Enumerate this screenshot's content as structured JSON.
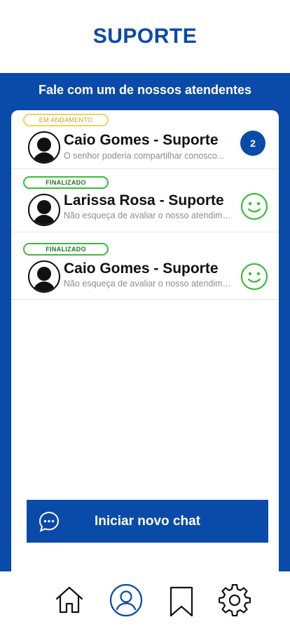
{
  "header": {
    "title": "SUPORTE"
  },
  "subtitle": "Fale com um de nossos atendentes",
  "chats": [
    {
      "status": "EM ANDAMENTO",
      "name": "Caio Gomes - Suporte",
      "preview": "O senhor poderia compartilhar conosco...",
      "unread": "2"
    },
    {
      "status": "FINALIZADO",
      "name": "Larissa Rosa - Suporte",
      "preview": "Não esqueça de avaliar o nosso atendimento",
      "rating_icon": "smiley-icon"
    },
    {
      "status": "FINALIZADO",
      "name": "Caio Gomes - Suporte",
      "preview": "Não esqueça de avaliar o nosso atendimento",
      "rating_icon": "smiley-icon"
    }
  ],
  "cta": {
    "label": "Iniciar novo chat",
    "icon": "chat-bubble-icon"
  },
  "nav": [
    {
      "name": "home",
      "icon": "home-icon"
    },
    {
      "name": "profile",
      "icon": "user-icon",
      "active": true
    },
    {
      "name": "saved",
      "icon": "bookmark-icon"
    },
    {
      "name": "settings",
      "icon": "gear-icon"
    }
  ],
  "colors": {
    "primary": "#0a4aa8",
    "in_progress": "#f1d357",
    "finished": "#3cbb3c"
  }
}
